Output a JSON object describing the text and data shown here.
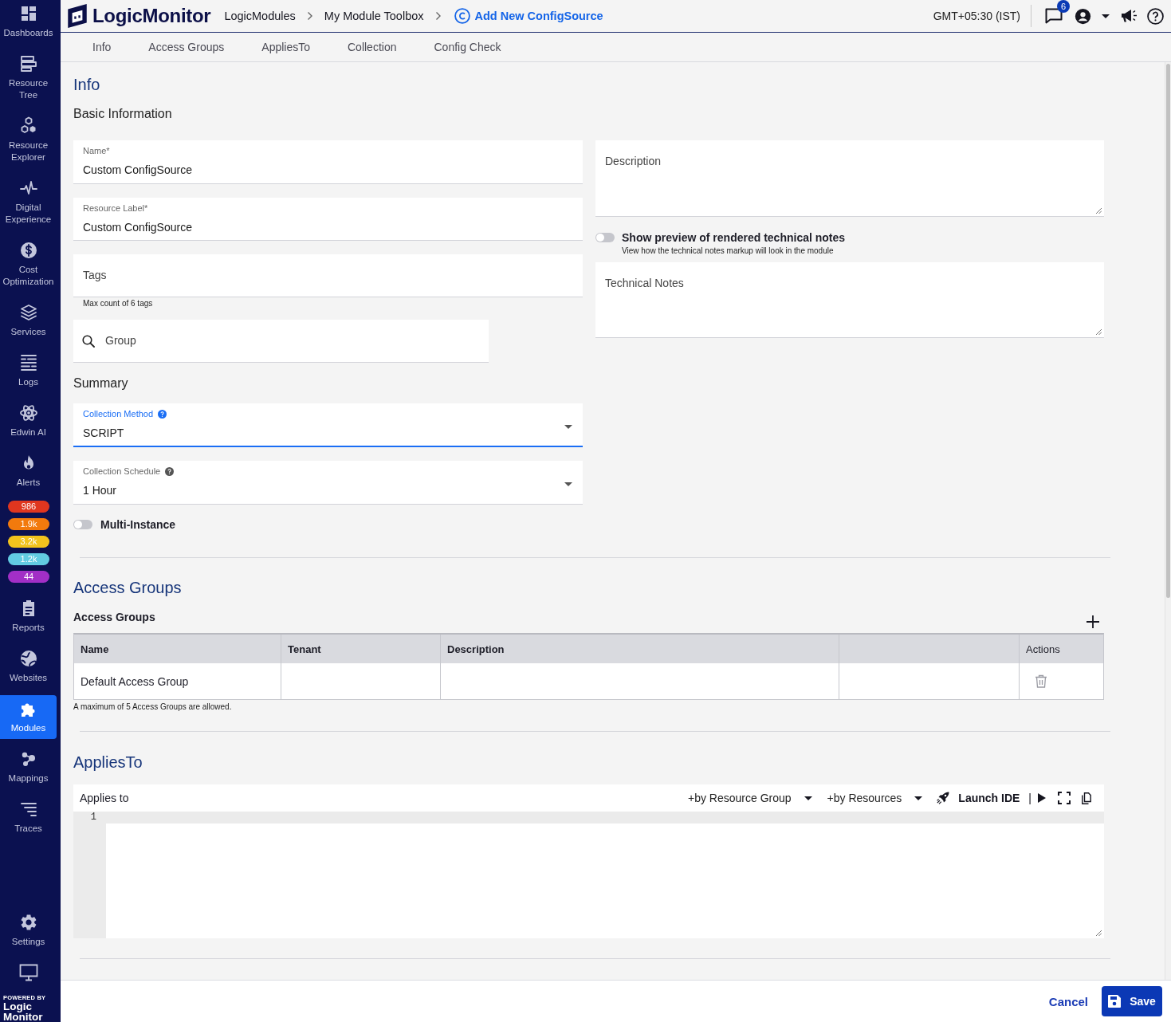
{
  "sidebar": {
    "top_items": [
      {
        "label": "Dashboards",
        "selected": false
      },
      {
        "label": "Resource Tree",
        "selected": false
      },
      {
        "label": "Resource Explorer",
        "selected": false
      },
      {
        "label": "Digital Experience",
        "selected": false
      },
      {
        "label": "Cost Optimization",
        "selected": false
      },
      {
        "label": "Services",
        "selected": false
      },
      {
        "label": "Logs",
        "selected": false
      },
      {
        "label": "Edwin AI",
        "selected": false
      },
      {
        "label": "Alerts",
        "selected": false
      }
    ],
    "alert_counts": [
      {
        "count": "986",
        "color": "#e0361f"
      },
      {
        "count": "1.9k",
        "color": "#f27a0d"
      },
      {
        "count": "3.2k",
        "color": "#f2c31d"
      },
      {
        "count": "1.2k",
        "color": "#62cbe2"
      },
      {
        "count": "44",
        "color": "#a22fc6"
      }
    ],
    "items": [
      {
        "label": "Reports",
        "selected": false
      },
      {
        "label": "Websites",
        "selected": false
      },
      {
        "label": "Modules",
        "selected": true
      },
      {
        "label": "Mappings",
        "selected": false
      },
      {
        "label": "Traces",
        "selected": false
      }
    ],
    "bottom_items": [
      {
        "label": "Settings",
        "selected": false
      }
    ],
    "brand": {
      "tagline": "POWERED BY",
      "name": "Logic Monitor"
    }
  },
  "header": {
    "brand": "LogicMonitor",
    "breadcrumbs": [
      {
        "label": "LogicModules",
        "current": false
      },
      {
        "label": "My Module Toolbox",
        "current": false
      },
      {
        "label": "Add New ConfigSource",
        "current": true
      }
    ],
    "timezone": "GMT+05:30 (IST)",
    "notification_count": "6"
  },
  "tabs": [
    {
      "label": "Info"
    },
    {
      "label": "Access Groups"
    },
    {
      "label": "AppliesTo"
    },
    {
      "label": "Collection"
    },
    {
      "label": "Config Check"
    }
  ],
  "info": {
    "title": "Info",
    "basic_title": "Basic Information",
    "name_field": {
      "label": "Name*",
      "value": "Custom ConfigSource"
    },
    "resource_label_field": {
      "label": "Resource Label*",
      "value": "Custom ConfigSource"
    },
    "tags_field": {
      "placeholder": "Tags",
      "helper": "Max count of 6 tags"
    },
    "group_search": {
      "placeholder": "Group"
    },
    "summary": {
      "title": "Summary",
      "selects": [
        {
          "label": "Collection Method",
          "value": "SCRIPT",
          "focused": true
        },
        {
          "label": "Collection Schedule",
          "value": "1 Hour",
          "focused": false
        }
      ],
      "multi_instance": {
        "label": "Multi-Instance",
        "on": false
      }
    },
    "description": {
      "placeholder": "Description"
    },
    "preview_toggle": {
      "label": "Show preview of rendered technical notes",
      "hint": "View how the technical notes markup will look in the module",
      "on": false
    },
    "technical_notes": {
      "placeholder": "Technical Notes"
    }
  },
  "access_groups": {
    "title": "Access Groups",
    "subtitle": "Access Groups",
    "columns": [
      {
        "label": "Name",
        "kind": "data"
      },
      {
        "label": "Tenant",
        "kind": "data"
      },
      {
        "label": "Description",
        "kind": "data"
      },
      {
        "kind": "blank"
      },
      {
        "label": "Actions",
        "kind": "actions"
      }
    ],
    "rows": [
      {
        "cells": [
          "Default Access Group"
        ]
      }
    ],
    "note": "A maximum of 5 Access Groups are allowed."
  },
  "applies_to": {
    "title": "AppliesTo",
    "editor": {
      "label": "Applies to",
      "dropdowns": [
        {
          "label": "+by Resource Group"
        },
        {
          "label": "+by Resources"
        }
      ],
      "launch": "Launch IDE",
      "separator": "|",
      "line_numbers": [
        "1"
      ]
    }
  },
  "footer": {
    "cancel": "Cancel",
    "save": "Save"
  }
}
